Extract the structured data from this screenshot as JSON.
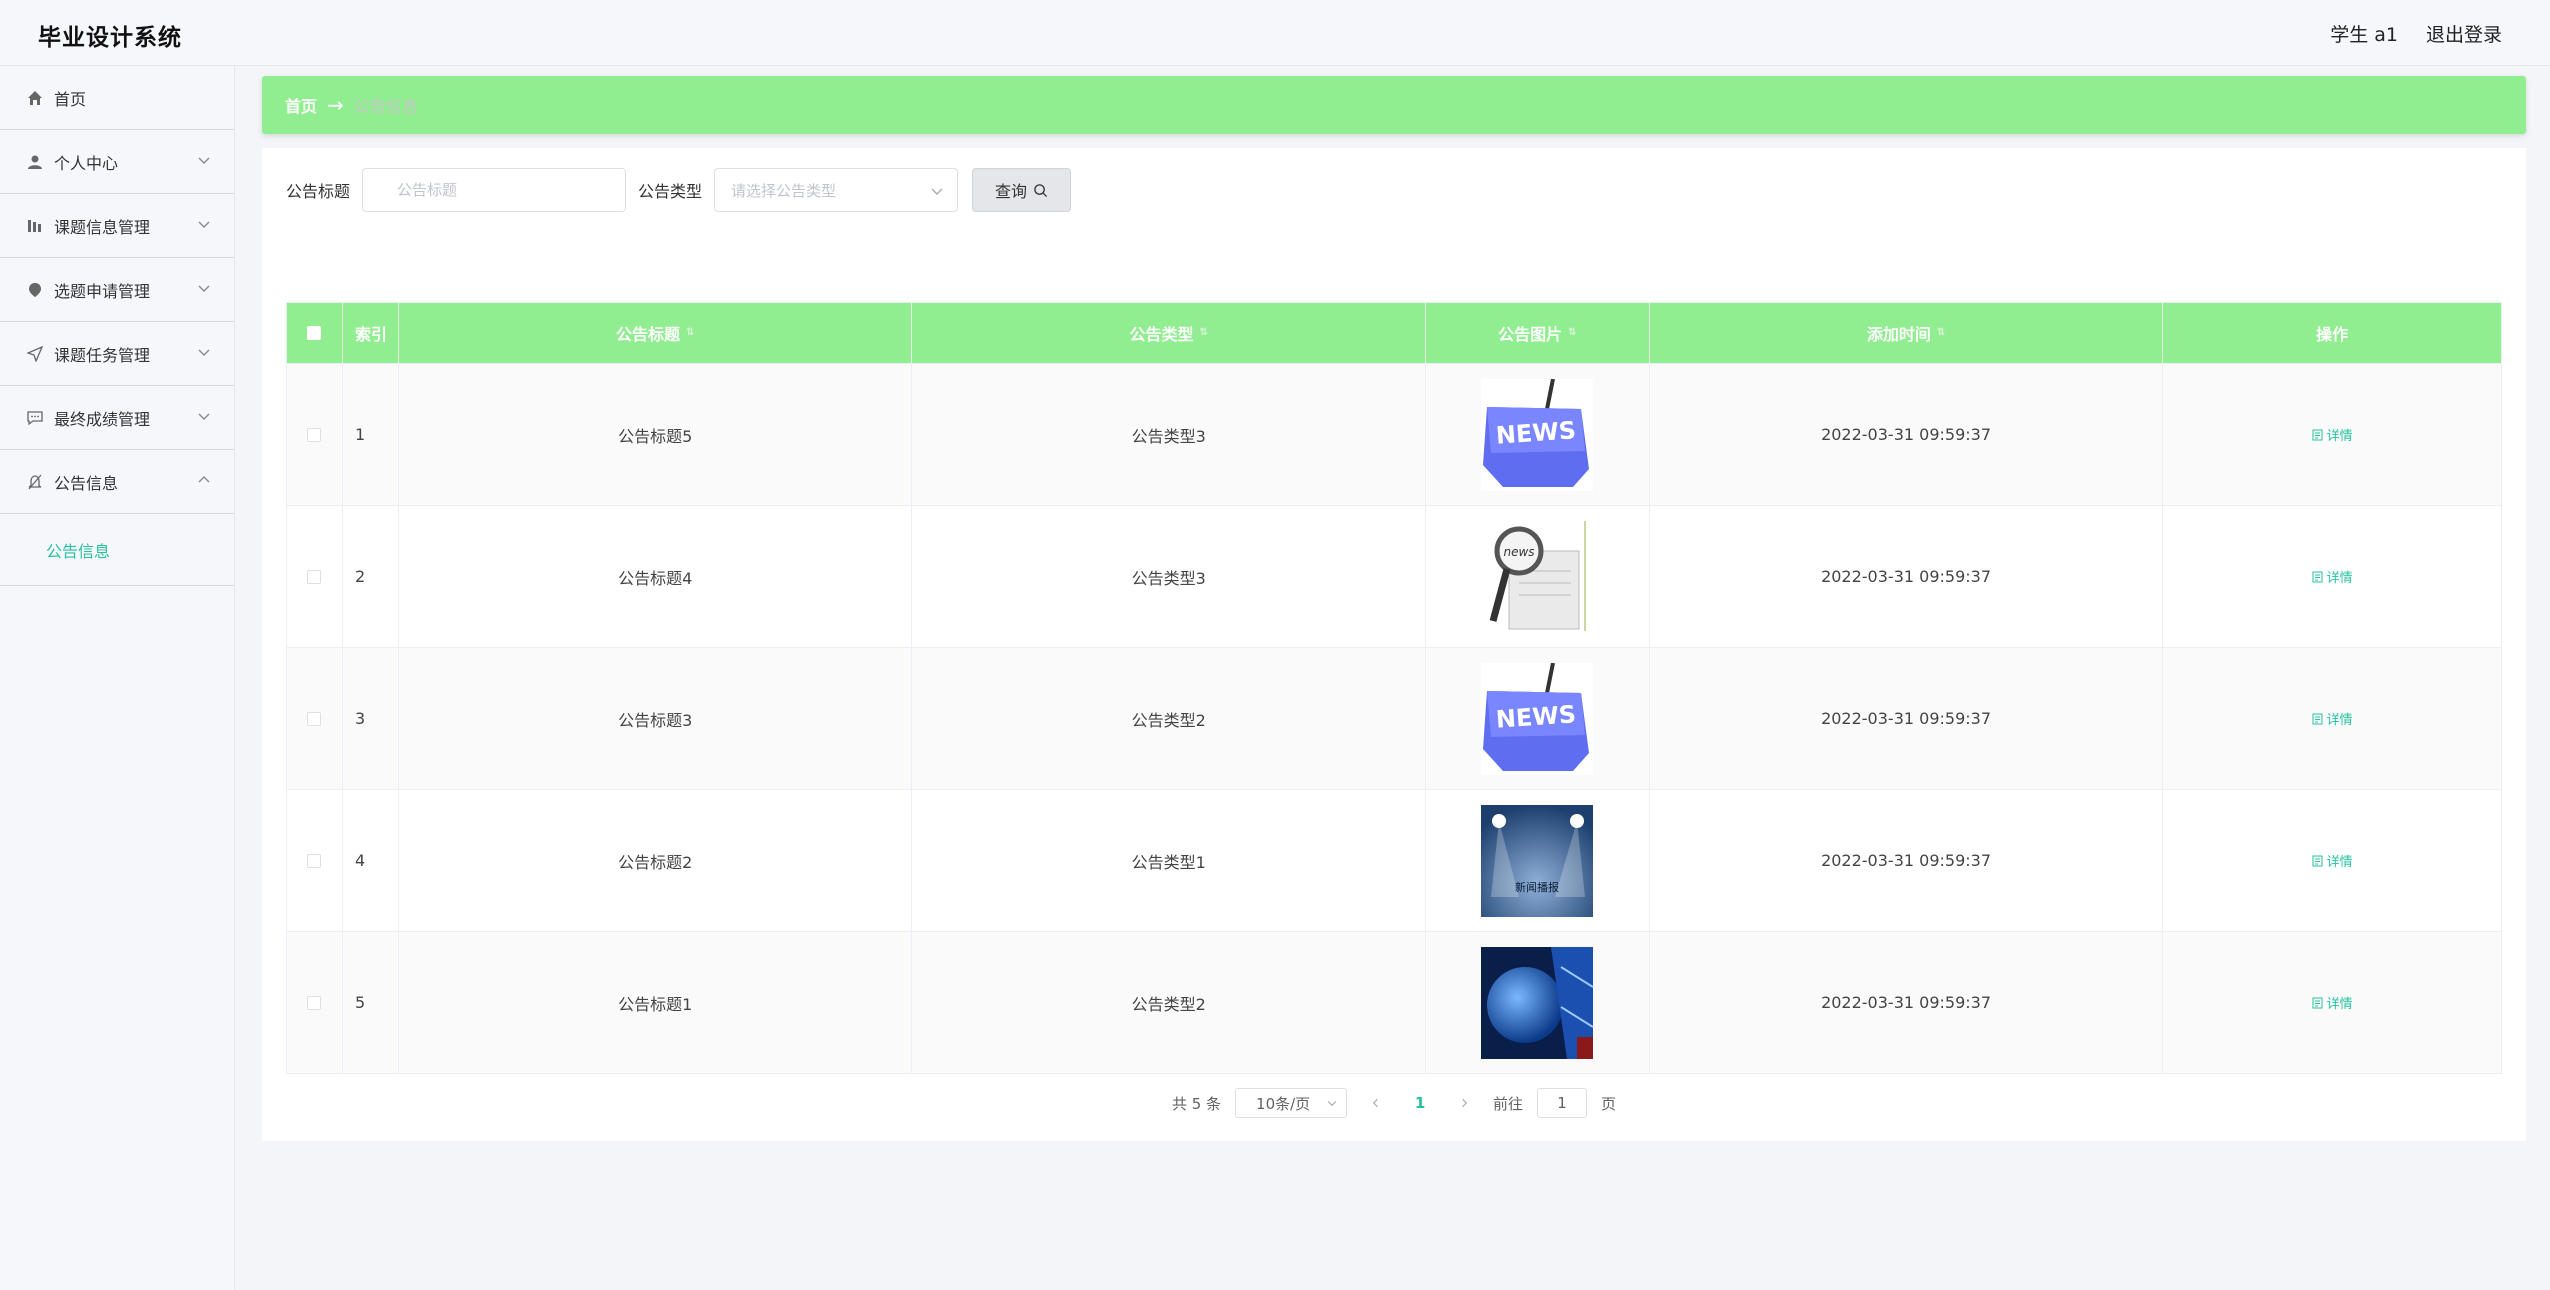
{
  "app": {
    "title": "毕业设计系统"
  },
  "header": {
    "user": "学生 a1",
    "logout": "退出登录"
  },
  "sidebar": {
    "items": [
      {
        "label": "首页",
        "icon": "home-icon"
      },
      {
        "label": "个人中心",
        "icon": "user-icon"
      },
      {
        "label": "课题信息管理",
        "icon": "chart-icon"
      },
      {
        "label": "选题申请管理",
        "icon": "pin-icon"
      },
      {
        "label": "课题任务管理",
        "icon": "send-icon"
      },
      {
        "label": "最终成绩管理",
        "icon": "chat-icon"
      },
      {
        "label": "公告信息",
        "icon": "bell-off-icon"
      }
    ],
    "submenu": {
      "label": "公告信息"
    }
  },
  "breadcrumb": {
    "home": "首页",
    "arrow": "→",
    "current": "公告信息"
  },
  "search": {
    "title_label": "公告标题",
    "title_placeholder": "公告标题",
    "type_label": "公告类型",
    "type_placeholder": "请选择公告类型",
    "query_button": "查询"
  },
  "table": {
    "columns": {
      "index": "索引",
      "title": "公告标题",
      "type": "公告类型",
      "image": "公告图片",
      "time": "添加时间",
      "action": "操作"
    },
    "rows": [
      {
        "index": "1",
        "title": "公告标题5",
        "type": "公告类型3",
        "image": "news-keyboard",
        "time": "2022-03-31 09:59:37",
        "action": "详情"
      },
      {
        "index": "2",
        "title": "公告标题4",
        "type": "公告类型3",
        "image": "news-magnifier",
        "time": "2022-03-31 09:59:37",
        "action": "详情"
      },
      {
        "index": "3",
        "title": "公告标题3",
        "type": "公告类型2",
        "image": "news-keyboard",
        "time": "2022-03-31 09:59:37",
        "action": "详情"
      },
      {
        "index": "4",
        "title": "公告标题2",
        "type": "公告类型1",
        "image": "stage-lights",
        "time": "2022-03-31 09:59:37",
        "action": "详情"
      },
      {
        "index": "5",
        "title": "公告标题1",
        "type": "公告类型2",
        "image": "blue-globe",
        "time": "2022-03-31 09:59:37",
        "action": "详情"
      }
    ],
    "stage_caption": "新闻播报"
  },
  "pagination": {
    "total": "共 5 条",
    "page_size": "10条/页",
    "current_page": "1",
    "goto_prefix": "前往",
    "goto_value": "1",
    "goto_suffix": "页"
  },
  "colors": {
    "accent": "#90ee90",
    "link": "#27c2a0"
  }
}
